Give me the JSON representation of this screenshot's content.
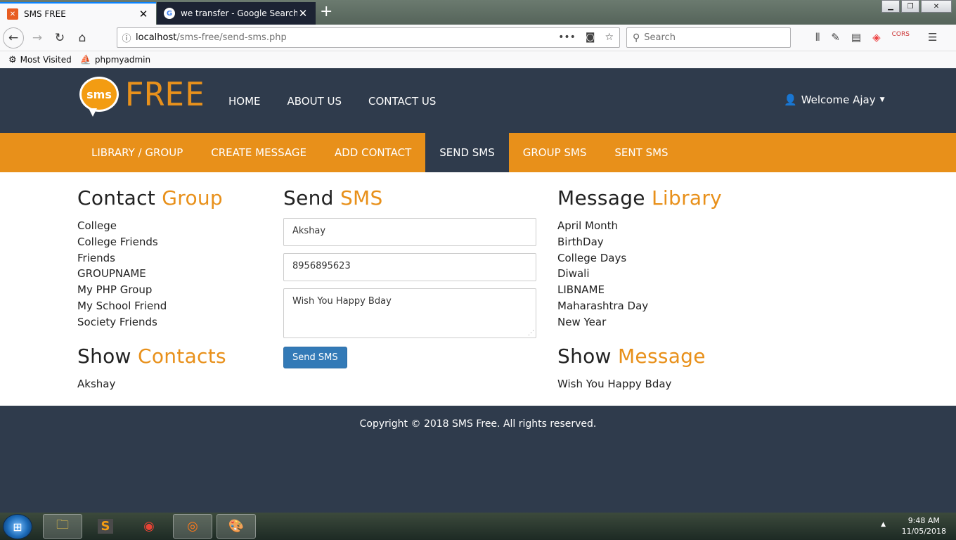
{
  "browser": {
    "tabs": [
      {
        "title": "SMS FREE",
        "favicon": "xampp-icon",
        "active": true
      },
      {
        "title": "we transfer - Google Search",
        "favicon": "google-icon",
        "active": false
      }
    ],
    "url_host": "localhost",
    "url_path": "/sms-free/send-sms.php",
    "search_placeholder": "Search",
    "bookmarks": [
      {
        "label": "Most Visited",
        "icon": "gear-icon"
      },
      {
        "label": "phpmyadmin",
        "icon": "phpmyadmin-icon"
      }
    ]
  },
  "site": {
    "logo_bubble": "sms",
    "logo_text": "FREE",
    "nav": [
      "HOME",
      "ABOUT US",
      "CONTACT US"
    ],
    "user": "Welcome Ajay",
    "subnav": [
      "LIBRARY / GROUP",
      "CREATE MESSAGE",
      "ADD CONTACT",
      "SEND SMS",
      "GROUP SMS",
      "SENT SMS"
    ],
    "subnav_active": "SEND SMS",
    "accent_color": "#e8901a",
    "header_color": "#2f3b4c"
  },
  "contact_group": {
    "title_plain": "Contact",
    "title_accent": "Group",
    "items": [
      "College",
      "College Friends",
      "Friends",
      "GROUPNAME",
      "My PHP Group",
      "My School Friend",
      "Society Friends"
    ],
    "show_title_plain": "Show",
    "show_title_accent": "Contacts",
    "show_items": [
      "Akshay"
    ]
  },
  "send_sms": {
    "title_plain": "Send",
    "title_accent": "SMS",
    "name_value": "Akshay",
    "phone_value": "8956895623",
    "message_value": "Wish You Happy Bday",
    "button_label": "Send SMS"
  },
  "message_library": {
    "title_plain": "Message",
    "title_accent": "Library",
    "items": [
      "April Month",
      "BirthDay",
      "College Days",
      "Diwali",
      "LIBNAME",
      "Maharashtra Day",
      "New Year"
    ],
    "show_title_plain": "Show",
    "show_title_accent": "Message",
    "show_items": [
      "Wish You Happy Bday"
    ]
  },
  "footer": {
    "copyright": "Copyright © 2018 SMS Free. All rights reserved."
  },
  "taskbar": {
    "time": "9:48 AM",
    "date": "11/05/2018"
  }
}
